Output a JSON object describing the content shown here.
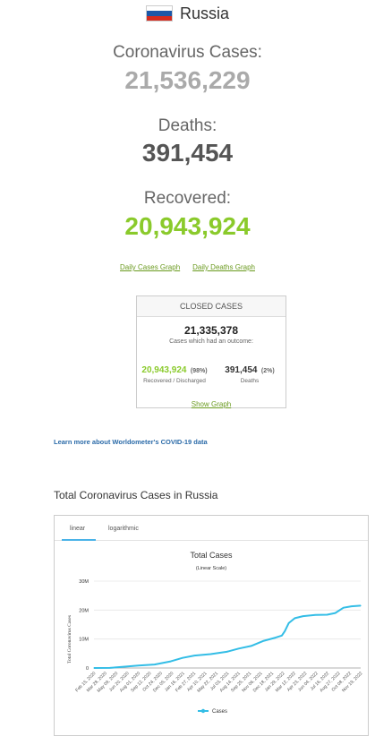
{
  "country": {
    "name": "Russia",
    "flag_colors": [
      "#ffffff",
      "#1c57a7",
      "#d52b1e"
    ]
  },
  "stats": {
    "cases_label": "Coronavirus Cases:",
    "cases_value": "21,536,229",
    "deaths_label": "Deaths:",
    "deaths_value": "391,454",
    "recovered_label": "Recovered:",
    "recovered_value": "20,943,924",
    "colors": {
      "cases": "#aaaaaa",
      "deaths": "#555555",
      "recovered": "#8aca2b"
    }
  },
  "links": {
    "daily_cases": "Daily Cases Graph",
    "daily_deaths": "Daily Deaths Graph",
    "learn_more": "Learn more about Worldometer's COVID-19 data"
  },
  "closed_cases": {
    "header": "CLOSED CASES",
    "total": "21,335,378",
    "subtitle": "Cases which had an outcome:",
    "recovered_value": "20,943,924",
    "recovered_pct": "(98%)",
    "recovered_label": "Recovered / Discharged",
    "deaths_value": "391,454",
    "deaths_pct": "(2%)",
    "deaths_label": "Deaths",
    "show_graph": "Show Graph"
  },
  "chart_section": {
    "title": "Total Coronavirus Cases in Russia",
    "tabs": [
      "linear",
      "logarithmic"
    ],
    "active_tab": "linear"
  },
  "chart_data": {
    "type": "line",
    "title": "Total Cases",
    "subtitle": "(Linear Scale)",
    "ylabel": "Total Coronavirus Cases",
    "xlabel": "",
    "ylim": [
      0,
      30000000
    ],
    "y_ticks": [
      "0",
      "10M",
      "20M",
      "30M"
    ],
    "y_tick_values": [
      0,
      10000000,
      20000000,
      30000000
    ],
    "x_tick_labels": [
      "Feb 15, 2020",
      "Mar 28, 2020",
      "May 09, 2020",
      "Jun 20, 2020",
      "Aug 01, 2020",
      "Sep 12, 2020",
      "Oct 24, 2020",
      "Dec 05, 2020",
      "Jan 16, 2021",
      "Feb 27, 2021",
      "Apr 10, 2021",
      "May 22, 2021",
      "Jul 03, 2021",
      "Aug 14, 2021",
      "Sep 25, 2021",
      "Nov 06, 2021",
      "Dec 18, 2021",
      "Jan 29, 2022",
      "Mar 12, 2022",
      "Apr 23, 2022",
      "Jun 04, 2022",
      "Jul 16, 2022",
      "Aug 27, 2022",
      "Oct 08, 2022",
      "Nov 19, 2022"
    ],
    "series": [
      {
        "name": "Cases",
        "color": "#33bde6",
        "x": [
          "2020-02-15",
          "2020-04-15",
          "2020-06-01",
          "2020-08-01",
          "2020-10-01",
          "2020-12-01",
          "2021-01-15",
          "2021-03-01",
          "2021-05-01",
          "2021-07-01",
          "2021-08-15",
          "2021-10-01",
          "2021-11-15",
          "2022-01-01",
          "2022-01-25",
          "2022-02-05",
          "2022-02-20",
          "2022-03-15",
          "2022-04-15",
          "2022-06-01",
          "2022-07-15",
          "2022-08-15",
          "2022-09-15",
          "2022-10-15",
          "2022-11-19"
        ],
        "values": [
          0,
          30000,
          400000,
          850000,
          1200000,
          2300000,
          3500000,
          4300000,
          4800000,
          5600000,
          6700000,
          7600000,
          9300000,
          10500000,
          11200000,
          12700000,
          15500000,
          17200000,
          17900000,
          18300000,
          18400000,
          19000000,
          20800000,
          21300000,
          21536229
        ]
      }
    ],
    "legend": "bottom",
    "grid": true
  }
}
